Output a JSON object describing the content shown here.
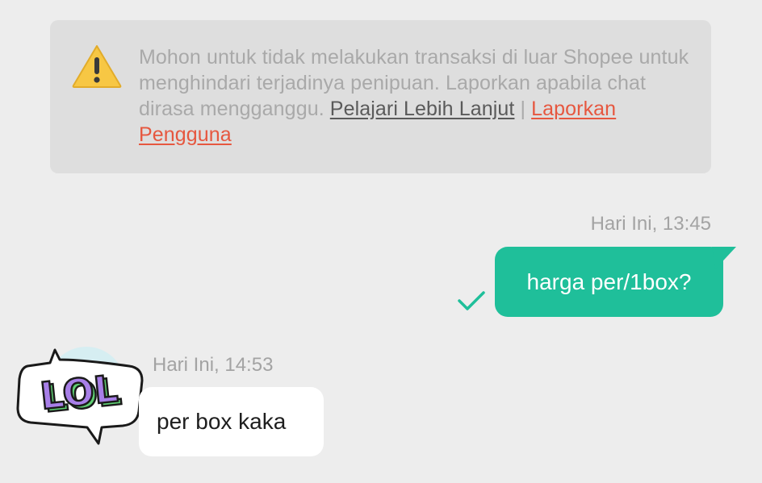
{
  "notice": {
    "text": "Mohon untuk tidak melakukan transaksi di luar Shopee untuk menghindari terjadinya penipuan. Laporkan apabila chat dirasa mengganggu. ",
    "learn_more": "Pelajari Lebih Lanjut",
    "separator": " | ",
    "report_user": "Laporkan Pengguna",
    "icon": "warning-icon"
  },
  "messages": {
    "outgoing": {
      "timestamp": "Hari Ini, 13:45",
      "text": "harga per/1box?",
      "status_icon": "check-icon"
    },
    "incoming": {
      "timestamp": "Hari Ini, 14:53",
      "text": "per box kaka",
      "avatar_sticker_text": "LOL"
    }
  },
  "colors": {
    "background": "#ededed",
    "notice_background": "#dedede",
    "outgoing_bubble": "#1fbf9a",
    "incoming_bubble": "#ffffff",
    "report_link": "#e6573f",
    "warning_yellow": "#f7c744"
  }
}
